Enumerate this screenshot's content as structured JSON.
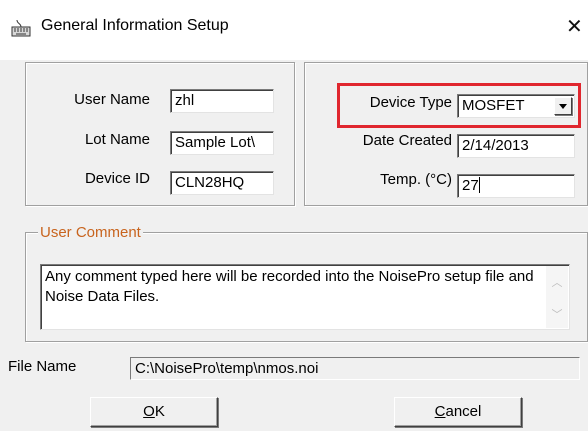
{
  "window": {
    "title": "General Information Setup",
    "icon": "keyboard-icon",
    "close_glyph": "✕"
  },
  "left_group": {
    "user_name_label": "User Name",
    "user_name_value": "zhl",
    "lot_name_label": "Lot Name",
    "lot_name_value": "Sample Lot\\",
    "device_id_label": "Device ID",
    "device_id_value": "CLN28HQ"
  },
  "right_group": {
    "device_type_label": "Device Type",
    "device_type_value": "MOSFET",
    "date_created_label": "Date Created",
    "date_created_value": "2/14/2013",
    "temp_label": "Temp. (°C)",
    "temp_value": "27"
  },
  "user_comment": {
    "legend": "User Comment",
    "text": "Any comment typed here will be recorded into the NoisePro setup file and Noise Data Files.",
    "scroll_up_glyph": "︿",
    "scroll_down_glyph": "﹀"
  },
  "file": {
    "label": "File Name",
    "value": "C:\\NoisePro\\temp\\nmos.noi"
  },
  "buttons": {
    "ok_mnemonic": "O",
    "ok_rest": "K",
    "cancel_mnemonic": "C",
    "cancel_rest": "ancel"
  },
  "colors": {
    "highlight": "#e0262e",
    "legend_text": "#c8641e",
    "dialog_bg": "#f0f0f0"
  }
}
